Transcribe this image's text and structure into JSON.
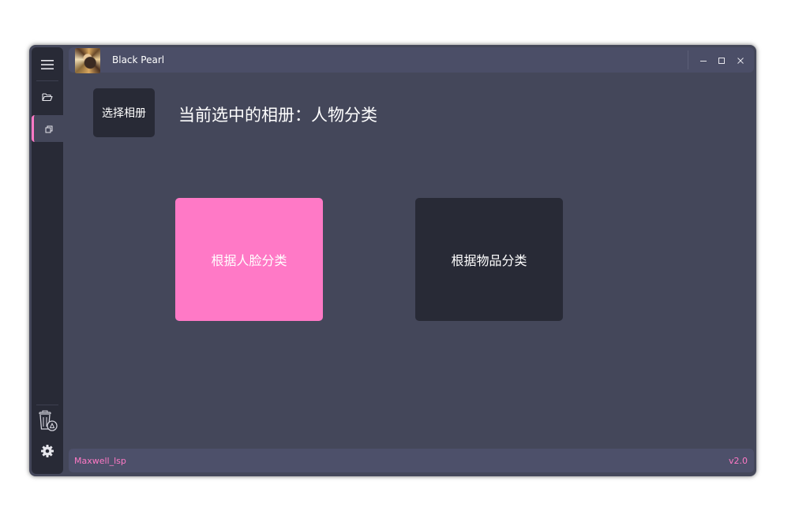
{
  "window": {
    "title": "Black Pearl",
    "controls": {
      "minimize_icon": "minimize-icon",
      "maximize_icon": "maximize-icon",
      "close_icon": "close-icon"
    }
  },
  "left_menu": {
    "items": [
      {
        "icon": "hamburger-menu-icon",
        "active": false
      },
      {
        "icon": "folder-open-icon",
        "active": false
      },
      {
        "icon": "copy-pages-icon",
        "active": true
      }
    ],
    "bottom_items": [
      {
        "icon": "trash-restore-icon"
      },
      {
        "icon": "gear-icon"
      }
    ]
  },
  "main": {
    "select_album_label": "选择相册",
    "current_album_text": "当前选中的相册：人物分类",
    "tiles": [
      {
        "label": "根据人脸分类",
        "color": "#ff79c6"
      },
      {
        "label": "根据物品分类",
        "color": "#282a36"
      }
    ]
  },
  "footer": {
    "credits": "Maxwell_lsp",
    "version": "v2.0"
  },
  "theme": {
    "accent": "#ff79c6",
    "background": "#44475a",
    "dark": "#282a36"
  }
}
